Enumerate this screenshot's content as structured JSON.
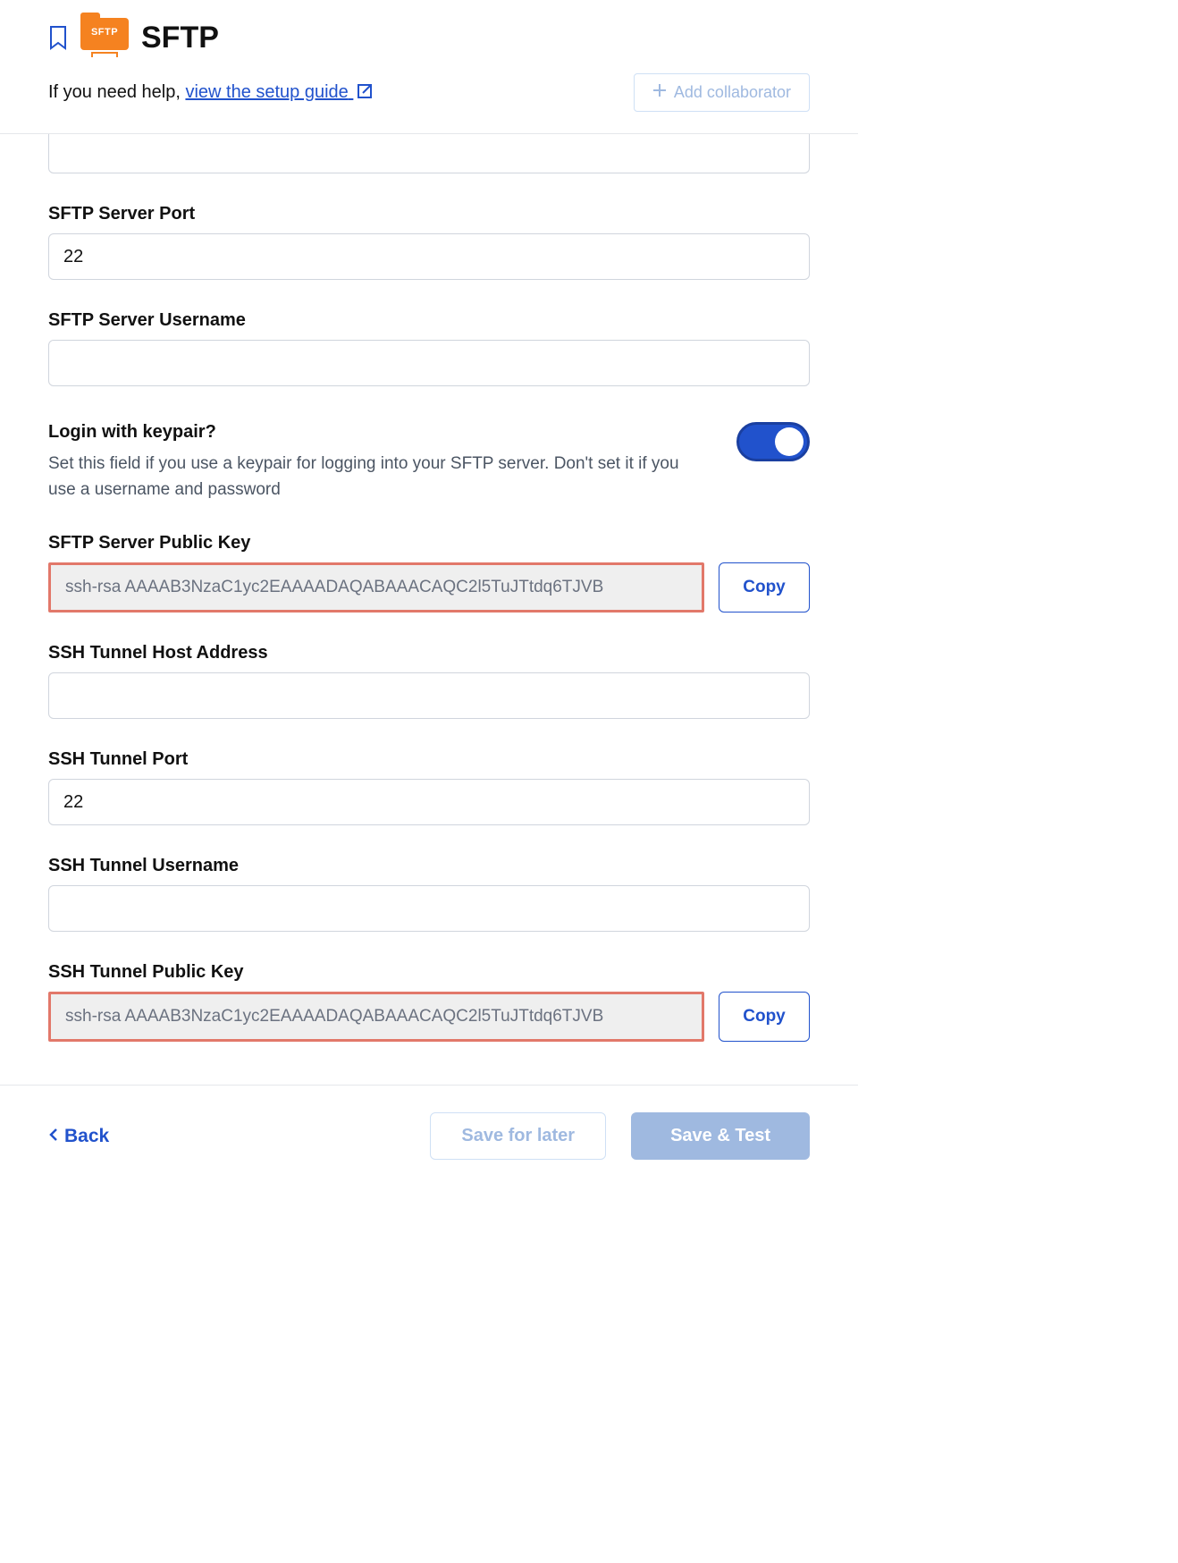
{
  "header": {
    "title": "SFTP",
    "logo_label": "SFTP",
    "help_prefix": "If you need help, ",
    "help_link": "view the setup guide",
    "add_collab": "Add collaborator"
  },
  "fields": {
    "server_port": {
      "label": "SFTP Server Port",
      "value": "22"
    },
    "server_username": {
      "label": "SFTP Server Username",
      "value": ""
    },
    "login_keypair": {
      "label": "Login with keypair?",
      "description": "Set this field if you use a keypair for logging into your SFTP server. Don't set it if you use a username and password",
      "enabled": true
    },
    "server_public_key": {
      "label": "SFTP Server Public Key",
      "value": "ssh-rsa AAAAB3NzaC1yc2EAAAADAQABAAACAQC2l5TuJTtdq6TJVB",
      "copy": "Copy"
    },
    "ssh_host": {
      "label": "SSH Tunnel Host Address",
      "value": ""
    },
    "ssh_port": {
      "label": "SSH Tunnel Port",
      "value": "22"
    },
    "ssh_username": {
      "label": "SSH Tunnel Username",
      "value": ""
    },
    "ssh_public_key": {
      "label": "SSH Tunnel Public Key",
      "value": "ssh-rsa AAAAB3NzaC1yc2EAAAADAQABAAACAQC2l5TuJTtdq6TJVB",
      "copy": "Copy"
    }
  },
  "footer": {
    "back": "Back",
    "save_later": "Save for later",
    "save_test": "Save & Test"
  }
}
